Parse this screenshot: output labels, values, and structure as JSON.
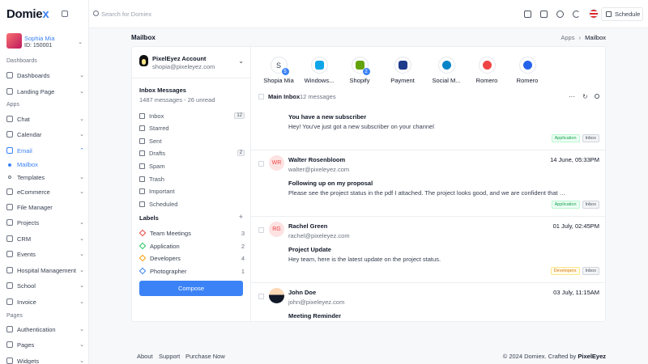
{
  "brand": {
    "name_main": "Domie",
    "name_x": "x"
  },
  "user": {
    "name": "Sophia Mia",
    "id": "ID: 150001"
  },
  "sidebar": {
    "sections": [
      "Dashboards",
      "Apps",
      "Pages"
    ],
    "items": [
      {
        "label": "Dashboards",
        "icon": "dashboard-icon"
      },
      {
        "label": "Landing Page",
        "icon": "landing-icon"
      },
      {
        "label": "Chat",
        "icon": "chat-icon"
      },
      {
        "label": "Calendar",
        "icon": "calendar-icon"
      },
      {
        "label": "Email",
        "icon": "email-icon"
      },
      {
        "label": "Mailbox"
      },
      {
        "label": "Templates"
      },
      {
        "label": "eCommerce",
        "icon": "cart-icon"
      },
      {
        "label": "File Manager",
        "icon": "folder-icon"
      },
      {
        "label": "Projects",
        "icon": "projects-icon"
      },
      {
        "label": "CRM",
        "icon": "crm-icon"
      },
      {
        "label": "Events",
        "icon": "events-icon"
      },
      {
        "label": "Hospital Management",
        "icon": "hospital-icon"
      },
      {
        "label": "School",
        "icon": "school-icon"
      },
      {
        "label": "Invoice",
        "icon": "invoice-icon"
      },
      {
        "label": "Authentication",
        "icon": "lock-icon"
      },
      {
        "label": "Pages",
        "icon": "pages-icon"
      },
      {
        "label": "Widgets",
        "icon": "widgets-icon"
      }
    ]
  },
  "topbar": {
    "search_placeholder": "Search for Domiex",
    "schedule_label": "Schedule"
  },
  "page": {
    "title": "Mailbox",
    "breadcrumb_parent": "Apps",
    "breadcrumb_sep": "›",
    "breadcrumb_current": "Mailbox"
  },
  "account": {
    "name": "PixelEyez Account",
    "email": "shopia@pixeleyez.com"
  },
  "inbox": {
    "title": "Inbox Messages",
    "subtitle": "1487 messages - 26 unread",
    "folders": [
      {
        "label": "Inbox",
        "count": "12"
      },
      {
        "label": "Starred",
        "count": ""
      },
      {
        "label": "Sent",
        "count": ""
      },
      {
        "label": "Drafts",
        "count": "2"
      },
      {
        "label": "Spam",
        "count": ""
      },
      {
        "label": "Trash",
        "count": ""
      },
      {
        "label": "Important",
        "count": ""
      },
      {
        "label": "Scheduled",
        "count": ""
      }
    ]
  },
  "labels": {
    "title": "Labels",
    "add": "+",
    "items": [
      {
        "label": "Team Meetings",
        "count": "3",
        "color": "#ef4444"
      },
      {
        "label": "Application",
        "count": "2",
        "color": "#22c55e"
      },
      {
        "label": "Developers",
        "count": "4",
        "color": "#f59e0b"
      },
      {
        "label": "Photographer",
        "count": "1",
        "color": "#3b82f6"
      }
    ]
  },
  "compose_label": "Compose",
  "apps": [
    {
      "label": "Shopia Mia",
      "badge": "5",
      "glyph": "S"
    },
    {
      "label": "Windows...",
      "badge": "",
      "color": "#0ea5e9"
    },
    {
      "label": "Shopify",
      "badge": "2",
      "color": "#65a30d"
    },
    {
      "label": "Payment",
      "badge": "",
      "color": "#1e3a8a"
    },
    {
      "label": "Social M...",
      "badge": "",
      "color": "#0284c7"
    },
    {
      "label": "Romero",
      "badge": "",
      "color": "#ef4444"
    },
    {
      "label": "Romero",
      "badge": "",
      "color": "#2563eb"
    }
  ],
  "main_inbox": {
    "title": "Main Inbox",
    "count": "12 messages"
  },
  "mails": [
    {
      "subject": "You have a new subscriber",
      "body": "Hey! You've just got a new subscriber on your channel",
      "tags": [
        "Application",
        "Inbox"
      ]
    },
    {
      "initials": "WR",
      "name": "Walter Rosenbloom",
      "email": "walter@pixeleyez.com",
      "date": "14 June, 05:33PM",
      "subject": "Following up on my proposal",
      "body": "Please see the project status in the pdf I attached. The project looks good, and we are confident that we will complete it...",
      "tags": [
        "Application",
        "Inbox"
      ]
    },
    {
      "initials": "RG",
      "name": "Rachel Green",
      "email": "rachel@pixeleyez.com",
      "date": "01 July, 02:45PM",
      "subject": "Project Update",
      "body": "Hey team, here is the latest update on the project status.",
      "tags": [
        "Developers",
        "Inbox"
      ]
    },
    {
      "initials": "",
      "name": "John Doe",
      "email": "john@pixeleyez.com",
      "date": "03 July, 11:15AM",
      "subject": "Meeting Reminder",
      "body": "",
      "tags": []
    }
  ],
  "footer": {
    "links": [
      "About",
      "Support",
      "Purchase Now"
    ],
    "copyright": "© 2024 Domiex. Crafted by",
    "crafted_by": "PixelEyez"
  }
}
